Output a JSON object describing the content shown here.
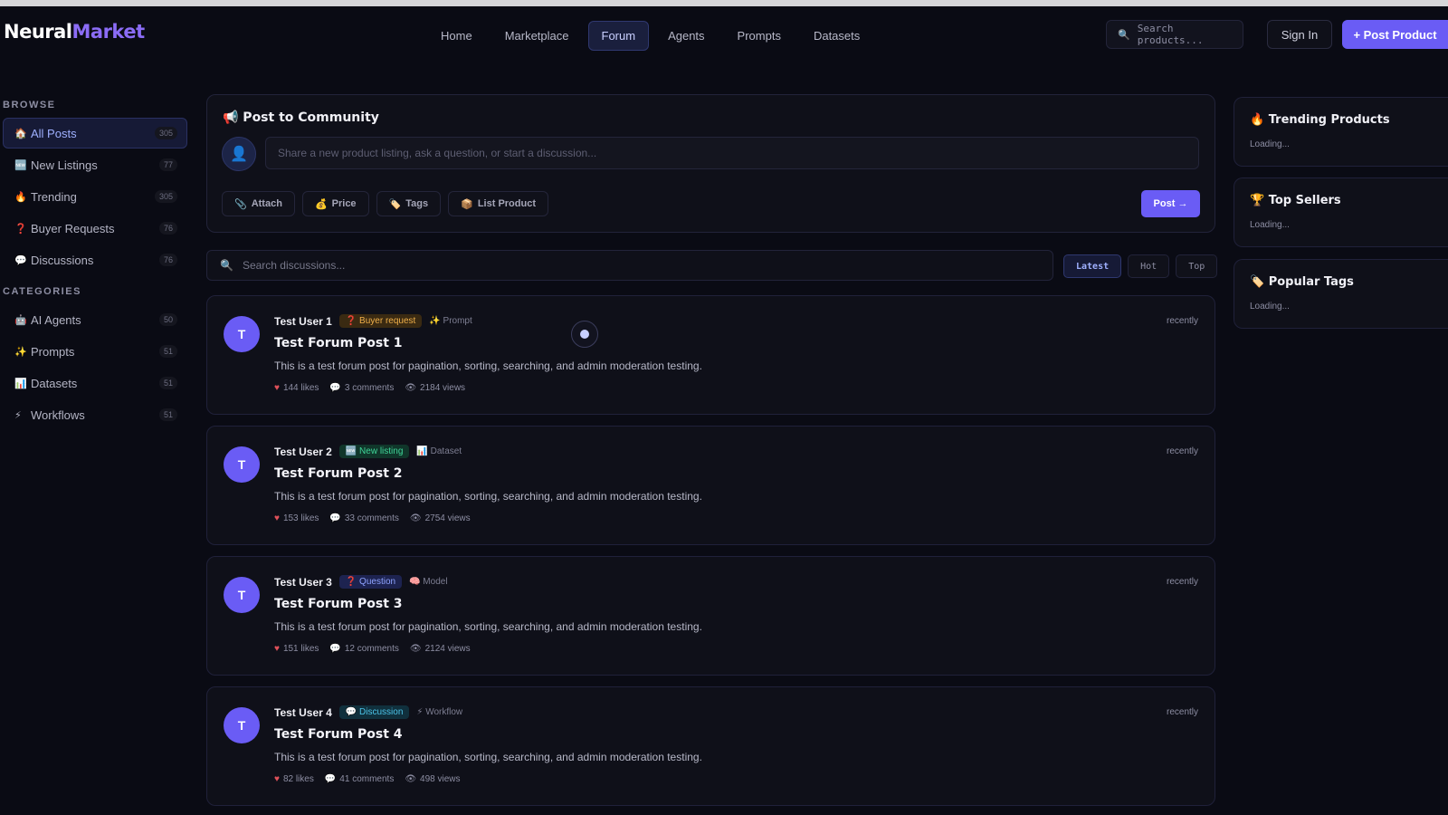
{
  "header": {
    "logo_part1": "Neural",
    "logo_part2": "Market",
    "nav": [
      "Home",
      "Marketplace",
      "Forum",
      "Agents",
      "Prompts",
      "Datasets"
    ],
    "active_nav": "Forum",
    "search_placeholder": "Search products...",
    "signin_label": "Sign In",
    "post_product_label": "+ Post Product"
  },
  "sidebar": {
    "browse_heading": "BROWSE",
    "browse": [
      {
        "icon": "🏠",
        "label": "All Posts",
        "count": "305"
      },
      {
        "icon": "🆕",
        "label": "New Listings",
        "count": "77"
      },
      {
        "icon": "🔥",
        "label": "Trending",
        "count": "305"
      },
      {
        "icon": "❓",
        "label": "Buyer Requests",
        "count": "76"
      },
      {
        "icon": "💬",
        "label": "Discussions",
        "count": "76"
      }
    ],
    "categories_heading": "CATEGORIES",
    "categories": [
      {
        "icon": "🤖",
        "label": "AI Agents",
        "count": "50"
      },
      {
        "icon": "✨",
        "label": "Prompts",
        "count": "51"
      },
      {
        "icon": "📊",
        "label": "Datasets",
        "count": "51"
      },
      {
        "icon": "⚡",
        "label": "Workflows",
        "count": "51"
      }
    ]
  },
  "composer": {
    "title": "📢 Post to Community",
    "avatar_icon": "👤",
    "placeholder": "Share a new product listing, ask a question, or start a discussion...",
    "tools": [
      {
        "icon": "📎",
        "label": "Attach"
      },
      {
        "icon": "💰",
        "label": "Price"
      },
      {
        "icon": "🏷️",
        "label": "Tags"
      },
      {
        "icon": "📦",
        "label": "List Product"
      }
    ],
    "post_label": "Post →"
  },
  "discussions": {
    "search_placeholder": "Search discussions...",
    "sort_tabs": [
      "Latest",
      "Hot",
      "Top"
    ],
    "active_sort": "Latest"
  },
  "posts": [
    {
      "initial": "T",
      "author": "Test User 1",
      "badge": "❓ Buyer request",
      "type": "✨ Prompt",
      "time": "recently",
      "title": "Test Forum Post 1",
      "desc": "This is a test forum post for pagination, sorting, searching, and admin moderation testing.",
      "likes": "144 likes",
      "comments": "3 comments",
      "views": "2184 views"
    },
    {
      "initial": "T",
      "author": "Test User 2",
      "badge": "🆕 New listing",
      "type": "📊 Dataset",
      "time": "recently",
      "title": "Test Forum Post 2",
      "desc": "This is a test forum post for pagination, sorting, searching, and admin moderation testing.",
      "likes": "153 likes",
      "comments": "33 comments",
      "views": "2754 views"
    },
    {
      "initial": "T",
      "author": "Test User 3",
      "badge": "❓ Question",
      "type": "🧠 Model",
      "time": "recently",
      "title": "Test Forum Post 3",
      "desc": "This is a test forum post for pagination, sorting, searching, and admin moderation testing.",
      "likes": "151 likes",
      "comments": "12 comments",
      "views": "2124 views"
    },
    {
      "initial": "T",
      "author": "Test User 4",
      "badge": "💬 Discussion",
      "type": "⚡ Workflow",
      "time": "recently",
      "title": "Test Forum Post 4",
      "desc": "This is a test forum post for pagination, sorting, searching, and admin moderation testing.",
      "likes": "82 likes",
      "comments": "41 comments",
      "views": "498 views"
    }
  ],
  "right_panels": [
    {
      "title": "🔥 Trending Products",
      "status": "Loading..."
    },
    {
      "title": "🏆 Top Sellers",
      "status": "Loading..."
    },
    {
      "title": "🏷️ Popular Tags",
      "status": "Loading..."
    }
  ],
  "colors": {
    "accent": "#6a5cf5",
    "background": "#0a0b14",
    "panel": "#0f1019"
  }
}
